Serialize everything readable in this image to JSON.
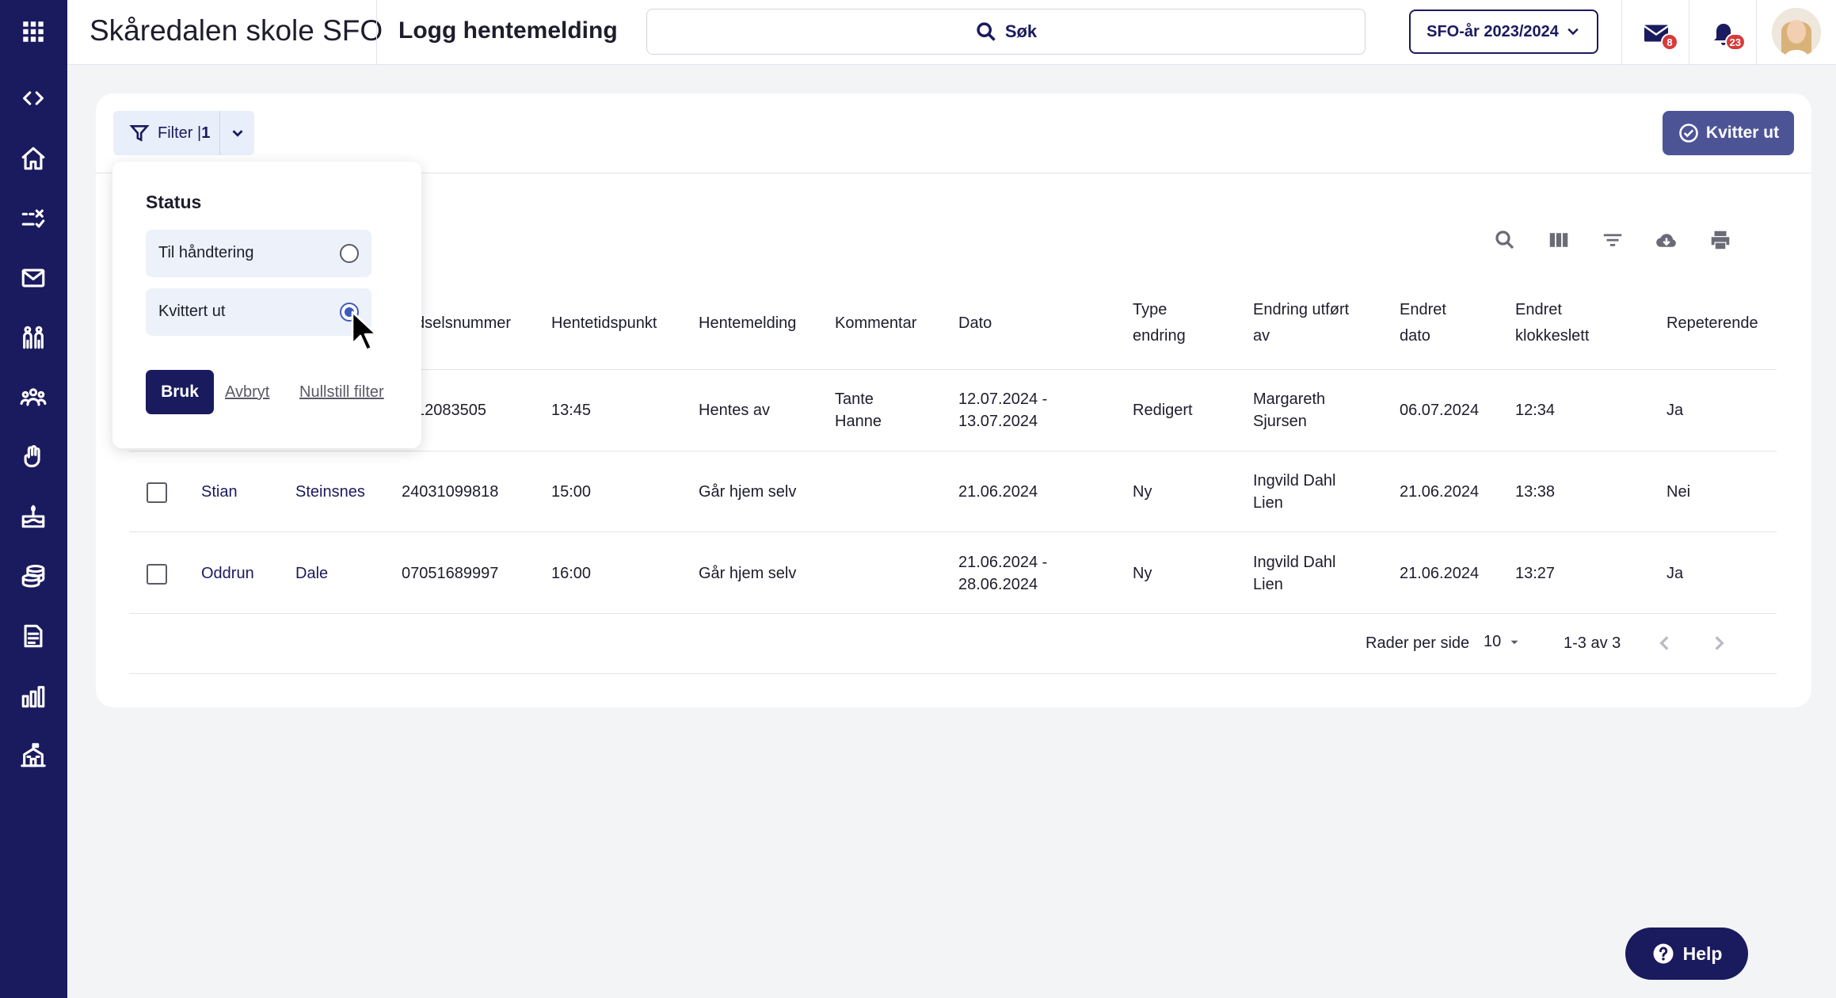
{
  "header": {
    "app_title": "Skåredalen skole SFO",
    "page_title": "Logg hentemelding",
    "search_label": "Søk",
    "year_select": "SFO-år 2023/2024",
    "mail_badge": "8",
    "notifications_badge": "23"
  },
  "toolbar": {
    "filter_label": "Filter |",
    "filter_count": "1",
    "kvitter_label": "Kvitter ut"
  },
  "filter_popover": {
    "title": "Status",
    "options": [
      {
        "label": "Til håndtering",
        "selected": false
      },
      {
        "label": "Kvittert ut",
        "selected": true
      }
    ],
    "apply_label": "Bruk",
    "cancel_label": "Avbryt",
    "reset_label": "Nullstill filter"
  },
  "table": {
    "columns": [
      "Fødselsnummer",
      "Hentetidspunkt",
      "Hentemelding",
      "Kommentar",
      "Dato",
      "Type endring",
      "Endring utført av",
      "Endret dato",
      "Endret klokkeslett",
      "Repeterende"
    ],
    "visible_headers": {
      "fodselsnummer": "dselsnummer",
      "hentetidspunkt": "Hentetidspunkt",
      "hentemelding": "Hentemelding",
      "kommentar": "Kommentar",
      "dato": "Dato",
      "type_1": "Type",
      "type_2": "endring",
      "endring_1": "Endring utført",
      "endring_2": "av",
      "endret_dato_1": "Endret",
      "endret_dato_2": "dato",
      "endret_kl_1": "Endret",
      "endret_kl_2": "klokkeslett",
      "repeterende": "Repeterende"
    },
    "rows": [
      {
        "fornavn": "",
        "etternavn": "",
        "fodselsnummer": "12083505",
        "hentetidspunkt": "13:45",
        "hentemelding": "Hentes av",
        "kommentar_1": "Tante",
        "kommentar_2": "Hanne",
        "dato_1": "12.07.2024 -",
        "dato_2": "13.07.2024",
        "type": "Redigert",
        "utfort_1": "Margareth",
        "utfort_2": "Sjursen",
        "endret_dato": "06.07.2024",
        "endret_kl": "12:34",
        "repeterende": "Ja"
      },
      {
        "fornavn": "Stian",
        "etternavn": "Steinsnes",
        "fodselsnummer": "24031099818",
        "hentetidspunkt": "15:00",
        "hentemelding": "Går hjem selv",
        "kommentar_1": "",
        "kommentar_2": "",
        "dato_1": "21.06.2024",
        "dato_2": "",
        "type": "Ny",
        "utfort_1": "Ingvild Dahl",
        "utfort_2": "Lien",
        "endret_dato": "21.06.2024",
        "endret_kl": "13:38",
        "repeterende": "Nei"
      },
      {
        "fornavn": "Oddrun",
        "etternavn": "Dale",
        "fodselsnummer": "07051689997",
        "hentetidspunkt": "16:00",
        "hentemelding": "Går hjem selv",
        "kommentar_1": "",
        "kommentar_2": "",
        "dato_1": "21.06.2024 -",
        "dato_2": "28.06.2024",
        "type": "Ny",
        "utfort_1": "Ingvild Dahl",
        "utfort_2": "Lien",
        "endret_dato": "21.06.2024",
        "endret_kl": "13:27",
        "repeterende": "Ja"
      }
    ]
  },
  "pagination": {
    "rows_per_page_label": "Rader per side",
    "rows_per_page_value": "10",
    "range": "1-3 av 3"
  },
  "help_label": "Help",
  "colors": {
    "sidebar": "#1a1a5e",
    "accent": "#4d5496",
    "badge": "#d83a3a"
  }
}
